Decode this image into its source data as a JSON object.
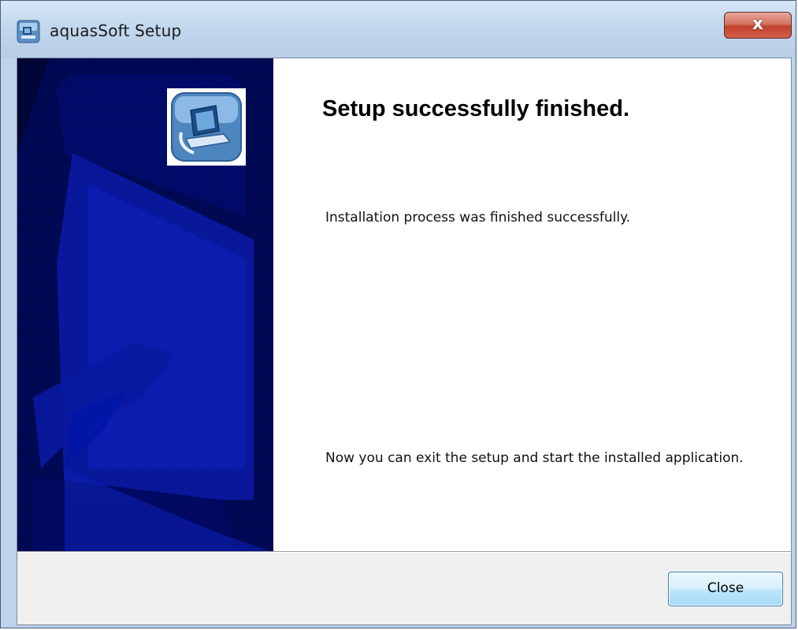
{
  "window": {
    "title": "aquasSoft Setup",
    "close_glyph": "x"
  },
  "sidebar": {
    "logo_icon": "installer-computer-icon",
    "background_color": "#00084f"
  },
  "content": {
    "heading": "Setup successfully finished.",
    "message": "Installation process was finished successfully.",
    "exit_message": "Now you can exit the setup and start the installed application."
  },
  "buttons": {
    "close_label": "Close"
  },
  "colors": {
    "accent": "#3c7fb1",
    "title_close": "#c3402c"
  }
}
